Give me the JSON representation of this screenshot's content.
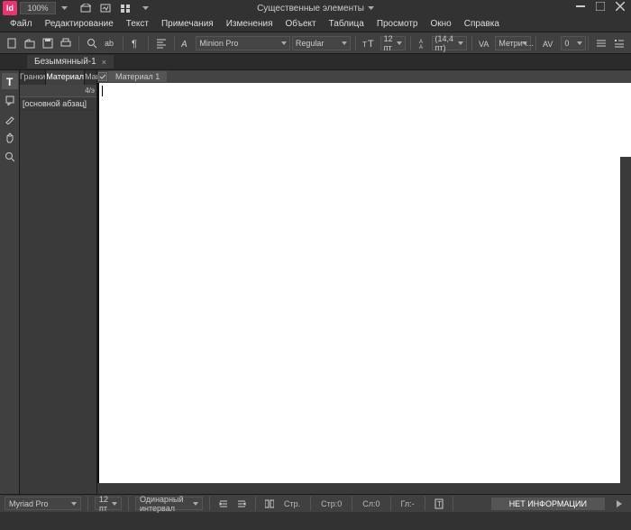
{
  "titlebar": {
    "app_icon": "Id",
    "zoom": "100%",
    "center_label": "Существенные элементы"
  },
  "menu": {
    "file": "Файл",
    "edit": "Редактирование",
    "text": "Текст",
    "notes": "Примечания",
    "changes": "Изменения",
    "object": "Объект",
    "table": "Таблица",
    "view": "Просмотр",
    "window": "Окно",
    "help": "Справка"
  },
  "ctrl": {
    "font": "Minion Pro",
    "style": "Regular",
    "size": "12 пт",
    "leading": "(14,4 пт)",
    "kerning_mode": "Метрич...",
    "tracking": "0"
  },
  "doc_tab": {
    "name": "Безымянный-1",
    "close": "×"
  },
  "story": {
    "tabs": {
      "tracks": "Гранки",
      "material": "Материал",
      "layout": "Макет"
    },
    "header": "4/э",
    "row0": "[основной абзац]"
  },
  "editor": {
    "flow_tab": "Материал 1"
  },
  "status": {
    "font": "Myriad Pro",
    "size": "12 пт",
    "spacing": "Одинарный интервал",
    "char": "Стр.",
    "line": "Стр:0",
    "col": "Сл:0",
    "glyph": "Гл:-",
    "noinfo": "НЕТ ИНФОРМАЦИИ"
  }
}
